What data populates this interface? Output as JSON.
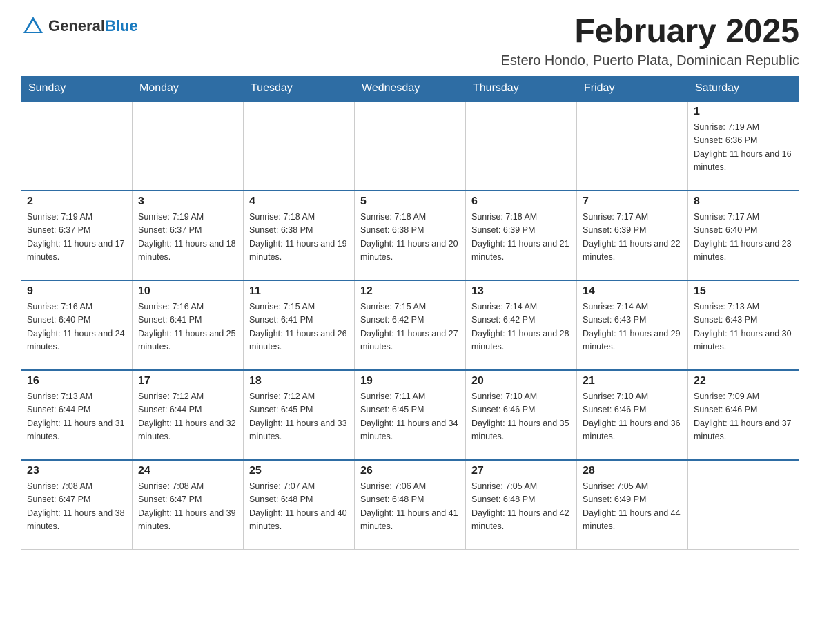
{
  "header": {
    "logo_general": "General",
    "logo_blue": "Blue",
    "month_title": "February 2025",
    "location": "Estero Hondo, Puerto Plata, Dominican Republic"
  },
  "weekdays": [
    "Sunday",
    "Monday",
    "Tuesday",
    "Wednesday",
    "Thursday",
    "Friday",
    "Saturday"
  ],
  "weeks": [
    [
      {
        "day": "",
        "sunrise": "",
        "sunset": "",
        "daylight": ""
      },
      {
        "day": "",
        "sunrise": "",
        "sunset": "",
        "daylight": ""
      },
      {
        "day": "",
        "sunrise": "",
        "sunset": "",
        "daylight": ""
      },
      {
        "day": "",
        "sunrise": "",
        "sunset": "",
        "daylight": ""
      },
      {
        "day": "",
        "sunrise": "",
        "sunset": "",
        "daylight": ""
      },
      {
        "day": "",
        "sunrise": "",
        "sunset": "",
        "daylight": ""
      },
      {
        "day": "1",
        "sunrise": "Sunrise: 7:19 AM",
        "sunset": "Sunset: 6:36 PM",
        "daylight": "Daylight: 11 hours and 16 minutes."
      }
    ],
    [
      {
        "day": "2",
        "sunrise": "Sunrise: 7:19 AM",
        "sunset": "Sunset: 6:37 PM",
        "daylight": "Daylight: 11 hours and 17 minutes."
      },
      {
        "day": "3",
        "sunrise": "Sunrise: 7:19 AM",
        "sunset": "Sunset: 6:37 PM",
        "daylight": "Daylight: 11 hours and 18 minutes."
      },
      {
        "day": "4",
        "sunrise": "Sunrise: 7:18 AM",
        "sunset": "Sunset: 6:38 PM",
        "daylight": "Daylight: 11 hours and 19 minutes."
      },
      {
        "day": "5",
        "sunrise": "Sunrise: 7:18 AM",
        "sunset": "Sunset: 6:38 PM",
        "daylight": "Daylight: 11 hours and 20 minutes."
      },
      {
        "day": "6",
        "sunrise": "Sunrise: 7:18 AM",
        "sunset": "Sunset: 6:39 PM",
        "daylight": "Daylight: 11 hours and 21 minutes."
      },
      {
        "day": "7",
        "sunrise": "Sunrise: 7:17 AM",
        "sunset": "Sunset: 6:39 PM",
        "daylight": "Daylight: 11 hours and 22 minutes."
      },
      {
        "day": "8",
        "sunrise": "Sunrise: 7:17 AM",
        "sunset": "Sunset: 6:40 PM",
        "daylight": "Daylight: 11 hours and 23 minutes."
      }
    ],
    [
      {
        "day": "9",
        "sunrise": "Sunrise: 7:16 AM",
        "sunset": "Sunset: 6:40 PM",
        "daylight": "Daylight: 11 hours and 24 minutes."
      },
      {
        "day": "10",
        "sunrise": "Sunrise: 7:16 AM",
        "sunset": "Sunset: 6:41 PM",
        "daylight": "Daylight: 11 hours and 25 minutes."
      },
      {
        "day": "11",
        "sunrise": "Sunrise: 7:15 AM",
        "sunset": "Sunset: 6:41 PM",
        "daylight": "Daylight: 11 hours and 26 minutes."
      },
      {
        "day": "12",
        "sunrise": "Sunrise: 7:15 AM",
        "sunset": "Sunset: 6:42 PM",
        "daylight": "Daylight: 11 hours and 27 minutes."
      },
      {
        "day": "13",
        "sunrise": "Sunrise: 7:14 AM",
        "sunset": "Sunset: 6:42 PM",
        "daylight": "Daylight: 11 hours and 28 minutes."
      },
      {
        "day": "14",
        "sunrise": "Sunrise: 7:14 AM",
        "sunset": "Sunset: 6:43 PM",
        "daylight": "Daylight: 11 hours and 29 minutes."
      },
      {
        "day": "15",
        "sunrise": "Sunrise: 7:13 AM",
        "sunset": "Sunset: 6:43 PM",
        "daylight": "Daylight: 11 hours and 30 minutes."
      }
    ],
    [
      {
        "day": "16",
        "sunrise": "Sunrise: 7:13 AM",
        "sunset": "Sunset: 6:44 PM",
        "daylight": "Daylight: 11 hours and 31 minutes."
      },
      {
        "day": "17",
        "sunrise": "Sunrise: 7:12 AM",
        "sunset": "Sunset: 6:44 PM",
        "daylight": "Daylight: 11 hours and 32 minutes."
      },
      {
        "day": "18",
        "sunrise": "Sunrise: 7:12 AM",
        "sunset": "Sunset: 6:45 PM",
        "daylight": "Daylight: 11 hours and 33 minutes."
      },
      {
        "day": "19",
        "sunrise": "Sunrise: 7:11 AM",
        "sunset": "Sunset: 6:45 PM",
        "daylight": "Daylight: 11 hours and 34 minutes."
      },
      {
        "day": "20",
        "sunrise": "Sunrise: 7:10 AM",
        "sunset": "Sunset: 6:46 PM",
        "daylight": "Daylight: 11 hours and 35 minutes."
      },
      {
        "day": "21",
        "sunrise": "Sunrise: 7:10 AM",
        "sunset": "Sunset: 6:46 PM",
        "daylight": "Daylight: 11 hours and 36 minutes."
      },
      {
        "day": "22",
        "sunrise": "Sunrise: 7:09 AM",
        "sunset": "Sunset: 6:46 PM",
        "daylight": "Daylight: 11 hours and 37 minutes."
      }
    ],
    [
      {
        "day": "23",
        "sunrise": "Sunrise: 7:08 AM",
        "sunset": "Sunset: 6:47 PM",
        "daylight": "Daylight: 11 hours and 38 minutes."
      },
      {
        "day": "24",
        "sunrise": "Sunrise: 7:08 AM",
        "sunset": "Sunset: 6:47 PM",
        "daylight": "Daylight: 11 hours and 39 minutes."
      },
      {
        "day": "25",
        "sunrise": "Sunrise: 7:07 AM",
        "sunset": "Sunset: 6:48 PM",
        "daylight": "Daylight: 11 hours and 40 minutes."
      },
      {
        "day": "26",
        "sunrise": "Sunrise: 7:06 AM",
        "sunset": "Sunset: 6:48 PM",
        "daylight": "Daylight: 11 hours and 41 minutes."
      },
      {
        "day": "27",
        "sunrise": "Sunrise: 7:05 AM",
        "sunset": "Sunset: 6:48 PM",
        "daylight": "Daylight: 11 hours and 42 minutes."
      },
      {
        "day": "28",
        "sunrise": "Sunrise: 7:05 AM",
        "sunset": "Sunset: 6:49 PM",
        "daylight": "Daylight: 11 hours and 44 minutes."
      },
      {
        "day": "",
        "sunrise": "",
        "sunset": "",
        "daylight": ""
      }
    ]
  ]
}
